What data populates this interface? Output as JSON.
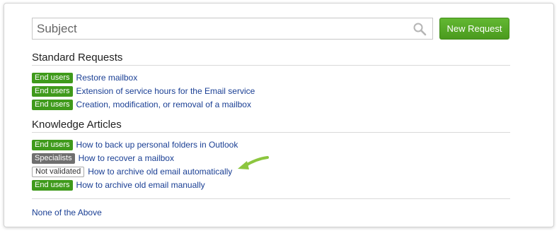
{
  "search": {
    "placeholder": "Subject",
    "icon": "search-icon"
  },
  "new_request_label": "New Request",
  "sections": [
    {
      "title": "Standard Requests",
      "items": [
        {
          "badge": "End users",
          "badge_style": "green",
          "link": "Restore mailbox"
        },
        {
          "badge": "End users",
          "badge_style": "green",
          "link": "Extension of service hours for the Email service"
        },
        {
          "badge": "End users",
          "badge_style": "green",
          "link": "Creation, modification, or removal of a mailbox"
        }
      ]
    },
    {
      "title": "Knowledge Articles",
      "items": [
        {
          "badge": "End users",
          "badge_style": "green",
          "link": "How to back up personal folders in Outlook"
        },
        {
          "badge": "Specialists",
          "badge_style": "gray",
          "link": "How to recover a mailbox"
        },
        {
          "badge": "Not validated",
          "badge_style": "outline",
          "link": "How to archive old email automatically"
        },
        {
          "badge": "End users",
          "badge_style": "green",
          "link": "How to archive old email manually"
        }
      ]
    }
  ],
  "none_of_above": "None of the Above",
  "colors": {
    "accent_green": "#4a9a1e",
    "badge_green": "#3f9a1b",
    "badge_gray": "#6f6f6f",
    "link_blue": "#1a3f94",
    "annotation_arrow": "#8cc63f"
  }
}
